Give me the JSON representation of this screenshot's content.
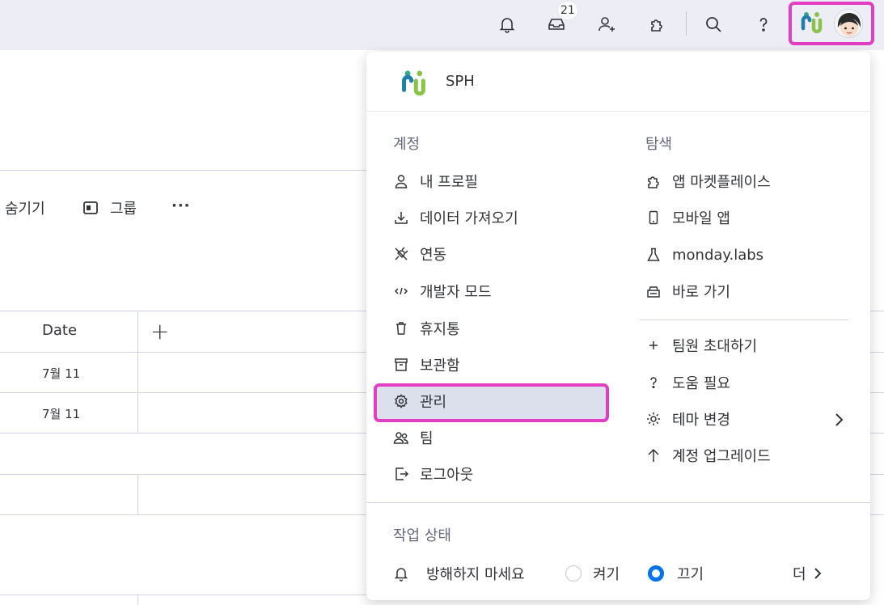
{
  "topbar": {
    "inbox_count": "21",
    "icons": [
      "bell-icon",
      "inbox-icon",
      "invite-user-icon",
      "apps-icon",
      "search-icon",
      "help-icon"
    ]
  },
  "board": {
    "toolbar": {
      "hide_label": "숨기기",
      "group_label": "그룹",
      "more_label": "···"
    },
    "table": {
      "date_header": "Date",
      "add_column": "+",
      "rows": [
        "7월 11",
        "7월 11"
      ]
    }
  },
  "menu": {
    "org_name": "SPH",
    "account": {
      "title": "계정",
      "items": [
        {
          "label": "내 프로필",
          "icon": "user-icon"
        },
        {
          "label": "데이터 가져오기",
          "icon": "download-icon"
        },
        {
          "label": "연동",
          "icon": "plug-icon"
        },
        {
          "label": "개발자 모드",
          "icon": "code-icon"
        },
        {
          "label": "휴지통",
          "icon": "trash-icon"
        },
        {
          "label": "보관함",
          "icon": "archive-icon"
        },
        {
          "label": "관리",
          "icon": "gear-icon"
        },
        {
          "label": "팀",
          "icon": "team-icon"
        },
        {
          "label": "로그아웃",
          "icon": "logout-icon"
        }
      ]
    },
    "explore": {
      "title": "탐색",
      "items": [
        {
          "label": "앱 마켓플레이스",
          "icon": "puzzle-icon"
        },
        {
          "label": "모바일 앱",
          "icon": "mobile-icon"
        },
        {
          "label": "monday.labs",
          "icon": "flask-icon"
        },
        {
          "label": "바로 가기",
          "icon": "keyboard-icon"
        }
      ],
      "extra_items": [
        {
          "label": "팀원 초대하기",
          "icon": "plus-icon"
        },
        {
          "label": "도움 필요",
          "icon": "question-icon"
        },
        {
          "label": "테마 변경",
          "icon": "sun-icon"
        },
        {
          "label": "계정 업그레이드",
          "icon": "arrow-up-icon"
        }
      ]
    },
    "work_status": {
      "title": "작업 상태",
      "dnd_label": "방해하지 마세요",
      "on_label": "켜기",
      "off_label": "끄기",
      "selected": "끄기",
      "more_label": "더"
    }
  },
  "colors": {
    "highlight": "#e23ec4",
    "accent": "#0073ea",
    "topbar_bg": "#ecedf5",
    "selected_bg": "#dcdfec"
  }
}
